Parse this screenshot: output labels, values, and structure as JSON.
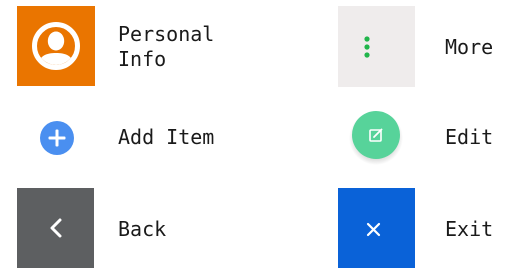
{
  "items": {
    "personal_info": {
      "label": "Personal Info",
      "icon": "user-icon",
      "color": "#ea7500"
    },
    "add_item": {
      "label": "Add Item",
      "icon": "plus-icon",
      "color": "#4a8ff0"
    },
    "back": {
      "label": "Back",
      "icon": "chevron-left-icon",
      "color": "#5d5f61"
    },
    "more": {
      "label": "More",
      "icon": "more-vertical-icon",
      "color": "#efecec",
      "icon_color": "#21b54b"
    },
    "edit": {
      "label": "Edit",
      "icon": "edit-icon",
      "color": "#57d39a"
    },
    "exit": {
      "label": "Exit",
      "icon": "close-icon",
      "color": "#0a62d8"
    }
  }
}
